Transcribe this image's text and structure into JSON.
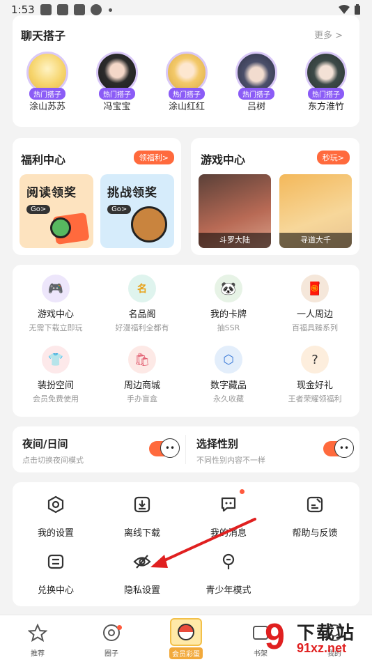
{
  "status": {
    "time": "1:53"
  },
  "chat": {
    "title": "聊天搭子",
    "more": "更多 >",
    "tag": "热门搭子",
    "avatars": [
      {
        "name": "涂山苏苏",
        "color": "#f6d46b"
      },
      {
        "name": "冯宝宝",
        "color": "#3b3b3b"
      },
      {
        "name": "涂山红红",
        "color": "#f3c96a"
      },
      {
        "name": "吕树",
        "color": "#4b4f6a"
      },
      {
        "name": "东方淮竹",
        "color": "#3d4a48"
      }
    ]
  },
  "welfare": {
    "title": "福利中心",
    "pill": "领福利>",
    "promos": [
      {
        "title": "阅读领奖",
        "go": "Go>"
      },
      {
        "title": "挑战领奖",
        "go": "Go>"
      }
    ]
  },
  "gamecenter": {
    "title": "游戏中心",
    "pill": "秒玩>",
    "games": [
      {
        "name": "斗罗大陆"
      },
      {
        "name": "寻道大千"
      }
    ]
  },
  "features": [
    {
      "label": "游戏中心",
      "sub": "无需下载立即玩",
      "icon": "gamepad-icon"
    },
    {
      "label": "名品阁",
      "sub": "好漫福利全都有",
      "icon": "brand-icon"
    },
    {
      "label": "我的卡牌",
      "sub": "抽SSR",
      "icon": "card-icon"
    },
    {
      "label": "一人周边",
      "sub": "百福具臻系列",
      "icon": "merch-icon"
    },
    {
      "label": "装扮空间",
      "sub": "会员免费使用",
      "icon": "shirt-icon"
    },
    {
      "label": "周边商城",
      "sub": "手办盲盒",
      "icon": "shop-icon"
    },
    {
      "label": "数字藏品",
      "sub": "永久收藏",
      "icon": "cube-icon"
    },
    {
      "label": "现金好礼",
      "sub": "王者荣耀领福利",
      "icon": "gift-icon"
    }
  ],
  "toggles": {
    "night": {
      "title": "夜间/日间",
      "sub": "点击切换夜间模式"
    },
    "gender": {
      "title": "选择性别",
      "sub": "不同性别内容不一样"
    }
  },
  "settings": [
    {
      "label": "我的设置",
      "icon": "settings-icon"
    },
    {
      "label": "离线下载",
      "icon": "download-icon"
    },
    {
      "label": "我的消息",
      "icon": "message-icon"
    },
    {
      "label": "帮助与反馈",
      "icon": "feedback-icon"
    },
    {
      "label": "兑换中心",
      "icon": "exchange-icon"
    },
    {
      "label": "隐私设置",
      "icon": "privacy-icon"
    },
    {
      "label": "青少年模式",
      "icon": "teen-icon"
    }
  ],
  "nav": {
    "items": [
      {
        "label": "推荐"
      },
      {
        "label": "圈子"
      },
      {
        "label": "会员彩蛋"
      },
      {
        "label": "书架"
      },
      {
        "label": "我的"
      }
    ]
  },
  "watermark": {
    "line1": "下载站",
    "line2": "91xz.net"
  },
  "colors": {
    "accent": "#ff6a3d",
    "tag": "#8b5cf6",
    "arrow": "#e02020"
  }
}
